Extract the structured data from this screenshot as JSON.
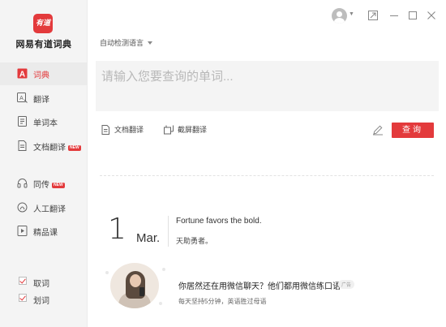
{
  "app": {
    "logo_text": "有道",
    "name": "网易有道词典"
  },
  "sidebar": {
    "items": [
      {
        "label": "词典",
        "active": true
      },
      {
        "label": "翻译"
      },
      {
        "label": "单词本"
      },
      {
        "label": "文档翻译",
        "badge": "NEW"
      },
      {
        "label": "同传",
        "badge": "NEW"
      },
      {
        "label": "人工翻译"
      },
      {
        "label": "精品课"
      }
    ],
    "checks": [
      {
        "label": "取词",
        "checked": true
      },
      {
        "label": "划词",
        "checked": true
      }
    ]
  },
  "main": {
    "language_select": "自动检测语言",
    "query_placeholder": "请输入您要查询的单词...",
    "tools": {
      "doc_translate": "文档翻译",
      "screenshot_translate": "截屏翻译"
    },
    "search_button": "查询"
  },
  "daily": {
    "day": "1",
    "month": "Mar.",
    "quote_en": "Fortune favors the bold.",
    "quote_zh": "天助勇者。"
  },
  "ad": {
    "title": "你居然还在用微信聊天？他们都用微信练口语",
    "tag": "广告",
    "subtitle": "每天坚持5分钟，英语胜过母语"
  },
  "colors": {
    "accent": "#e33a3c",
    "sidebar_bg": "#f4f4f4"
  }
}
